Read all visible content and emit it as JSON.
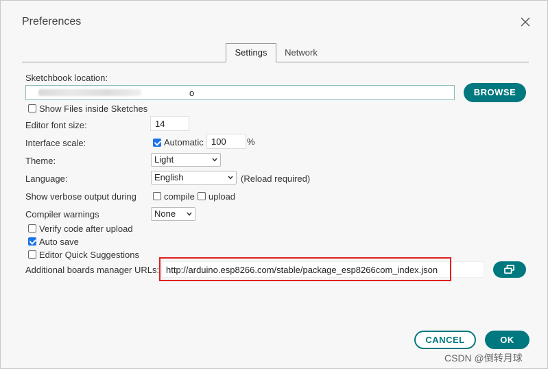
{
  "dialog": {
    "title": "Preferences"
  },
  "tabs": [
    {
      "label": "Settings",
      "active": true
    },
    {
      "label": "Network",
      "active": false
    }
  ],
  "sketchbook": {
    "label": "Sketchbook location:",
    "value_suffix": "o",
    "browse_label": "BROWSE",
    "show_files_label": "Show Files inside Sketches",
    "show_files_checked": false
  },
  "editor_font": {
    "label": "Editor font size:",
    "value": "14"
  },
  "interface_scale": {
    "label": "Interface scale:",
    "automatic_label": "Automatic",
    "automatic_checked": true,
    "value": "100",
    "unit": "%"
  },
  "theme": {
    "label": "Theme:",
    "value": "Light"
  },
  "language": {
    "label": "Language:",
    "value": "English",
    "note": "(Reload required)"
  },
  "verbose": {
    "label": "Show verbose output during",
    "compile_label": "compile",
    "compile_checked": false,
    "upload_label": "upload",
    "upload_checked": false
  },
  "compiler_warnings": {
    "label": "Compiler warnings",
    "value": "None"
  },
  "options": [
    {
      "label": "Verify code after upload",
      "checked": false
    },
    {
      "label": "Auto save",
      "checked": true
    },
    {
      "label": "Editor Quick Suggestions",
      "checked": false
    }
  ],
  "boards_urls": {
    "label": "Additional boards manager URLs:",
    "value": "http://arduino.esp8266.com/stable/package_esp8266com_index.json"
  },
  "footer": {
    "cancel_label": "CANCEL",
    "ok_label": "OK"
  },
  "watermark": "CSDN @倒转月球",
  "colors": {
    "accent": "#00787f",
    "checkbox": "#1a73e8",
    "highlight": "#e02020"
  },
  "icons": [
    "close-icon",
    "chevron-down-icon",
    "open-in-window-icon"
  ]
}
